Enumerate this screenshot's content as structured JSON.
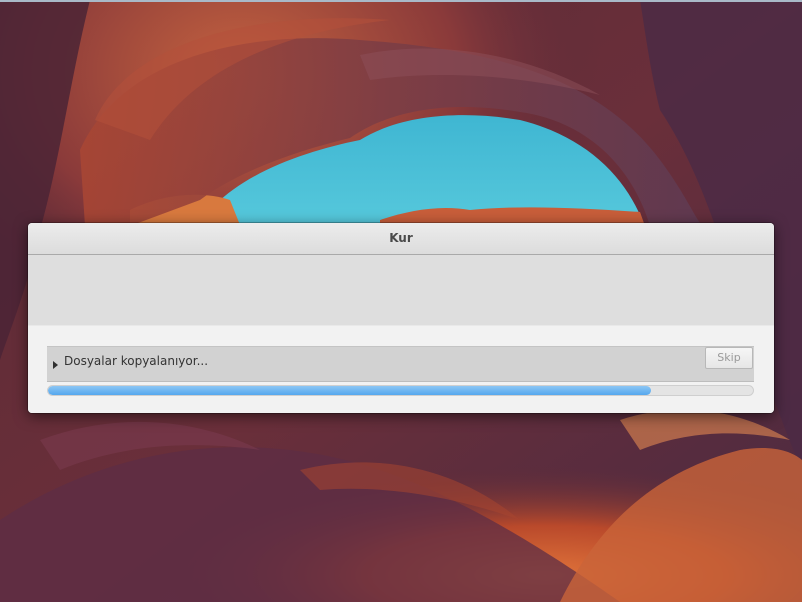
{
  "window": {
    "title": "Kur"
  },
  "progress": {
    "status_text": "Dosyalar kopyalanıyor...",
    "skip_label": "Skip",
    "fraction": 0.856
  },
  "colors": {
    "progress_fill": "#55a7ee",
    "sky": "#48c3d8",
    "rock_red": "#b4492e",
    "rock_purple": "#5a3048"
  }
}
